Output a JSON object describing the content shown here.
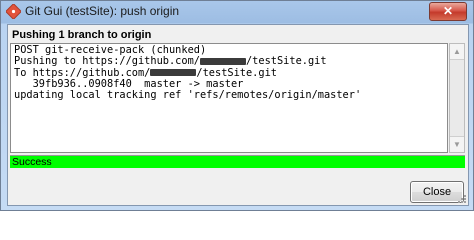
{
  "window": {
    "title": "Git Gui (testSite): push origin",
    "close_glyph": "✕",
    "app_icon": "git-gui-icon"
  },
  "heading": "Pushing 1 branch to origin",
  "log": {
    "lines": [
      {
        "before": "POST git-receive-pack (chunked)",
        "redacted": false,
        "after": ""
      },
      {
        "before": "Pushing to https://github.com/",
        "redacted": true,
        "after": "/testSite.git"
      },
      {
        "before": "To https://github.com/",
        "redacted": true,
        "after": "/testSite.git"
      },
      {
        "before": "   39fb936..0908f40  master -> master",
        "redacted": false,
        "after": ""
      },
      {
        "before": "updating local tracking ref 'refs/remotes/origin/master'",
        "redacted": false,
        "after": ""
      }
    ]
  },
  "status": {
    "text": "Success",
    "color": "#00ff00"
  },
  "buttons": {
    "close_label": "Close"
  }
}
